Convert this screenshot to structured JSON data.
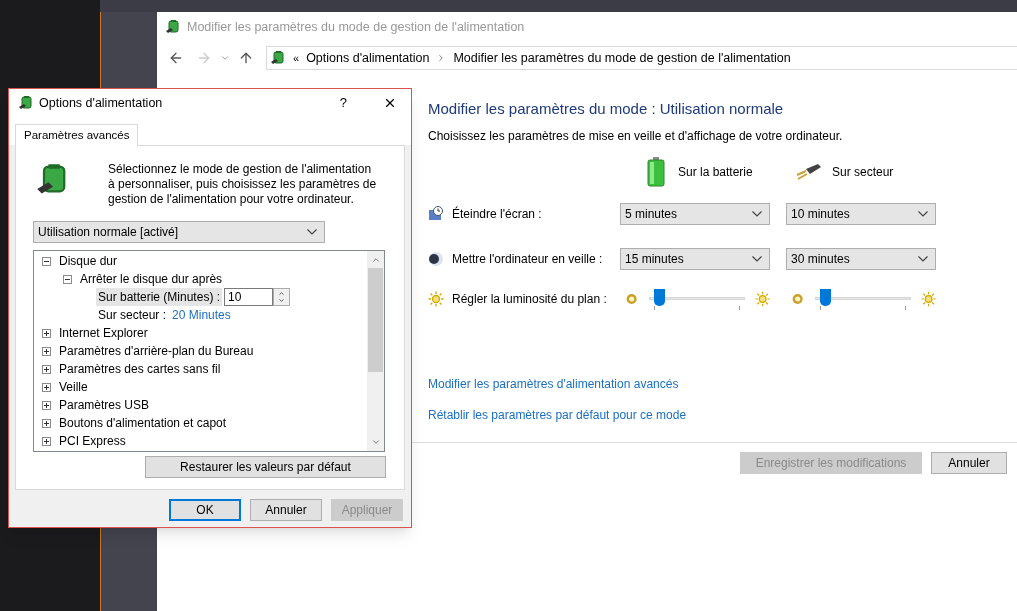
{
  "main_window": {
    "title": "Modifier les paramètres du mode de gestion de l'alimentation",
    "breadcrumb_prefix": "«",
    "breadcrumb": [
      "Options d'alimentation",
      "Modifier les paramètres du mode de gestion de l'alimentation"
    ],
    "heading": "Modifier les paramètres du mode : Utilisation normale",
    "subtitle": "Choisissez les paramètres de mise en veille et d'affichage de votre ordinateur.",
    "columns": [
      "Sur la batterie",
      "Sur secteur"
    ],
    "settings": [
      {
        "kind": "select",
        "label": "Éteindre l'écran :",
        "values": [
          {
            "value": "5 minutes"
          },
          {
            "value": "10 minutes"
          }
        ]
      },
      {
        "kind": "select",
        "label": "Mettre l'ordinateur en veille :",
        "values": [
          {
            "value": "15 minutes"
          },
          {
            "value": "30 minutes"
          }
        ]
      },
      {
        "kind": "slider",
        "label": "Régler la luminosité du plan :",
        "values": [
          {
            "level": 0.05
          },
          {
            "level": 0.05
          }
        ]
      }
    ],
    "links": [
      "Modifier les paramètres d'alimentation avancés",
      "Rétablir les paramètres par défaut pour ce mode"
    ],
    "buttons": [
      {
        "label": "Enregistrer les modifications",
        "disabled": true
      },
      {
        "label": "Annuler",
        "disabled": false
      }
    ]
  },
  "dialog": {
    "title": "Options d'alimentation",
    "help": "?",
    "tabs": [
      {
        "label": "Paramètres avancés",
        "selected": true
      }
    ],
    "description": "Sélectionnez le mode de gestion de l'alimentation à personnaliser, puis choisissez les paramètres de gestion de l'alimentation pour votre ordinateur.",
    "plan_select": {
      "value": "Utilisation normale [activé]"
    },
    "tree": [
      {
        "kind": "group",
        "label": "Disque dur",
        "expanded": true,
        "children": [
          {
            "kind": "group",
            "label": "Arrêter le disque dur après",
            "expanded": true,
            "children": [
              {
                "kind": "spin",
                "label": "Sur batterie (Minutes) :",
                "value": "10",
                "selected": true
              },
              {
                "kind": "value",
                "label": "Sur secteur :",
                "value": "20 Minutes",
                "selected": false
              }
            ]
          }
        ]
      },
      {
        "kind": "group",
        "label": "Internet Explorer",
        "expanded": false
      },
      {
        "kind": "group",
        "label": "Paramètres d'arrière-plan du Bureau",
        "expanded": false
      },
      {
        "kind": "group",
        "label": "Paramètres des cartes sans fil",
        "expanded": false
      },
      {
        "kind": "group",
        "label": "Veille",
        "expanded": false
      },
      {
        "kind": "group",
        "label": "Paramètres USB",
        "expanded": false
      },
      {
        "kind": "group",
        "label": "Boutons d'alimentation et capot",
        "expanded": false
      },
      {
        "kind": "group",
        "label": "PCI Express",
        "expanded": false
      }
    ],
    "restore_button": "Restaurer les valeurs par défaut",
    "buttons": [
      {
        "label": "OK",
        "default": true,
        "disabled": false
      },
      {
        "label": "Annuler",
        "default": false,
        "disabled": false
      },
      {
        "label": "Appliquer",
        "default": false,
        "disabled": true
      }
    ]
  }
}
